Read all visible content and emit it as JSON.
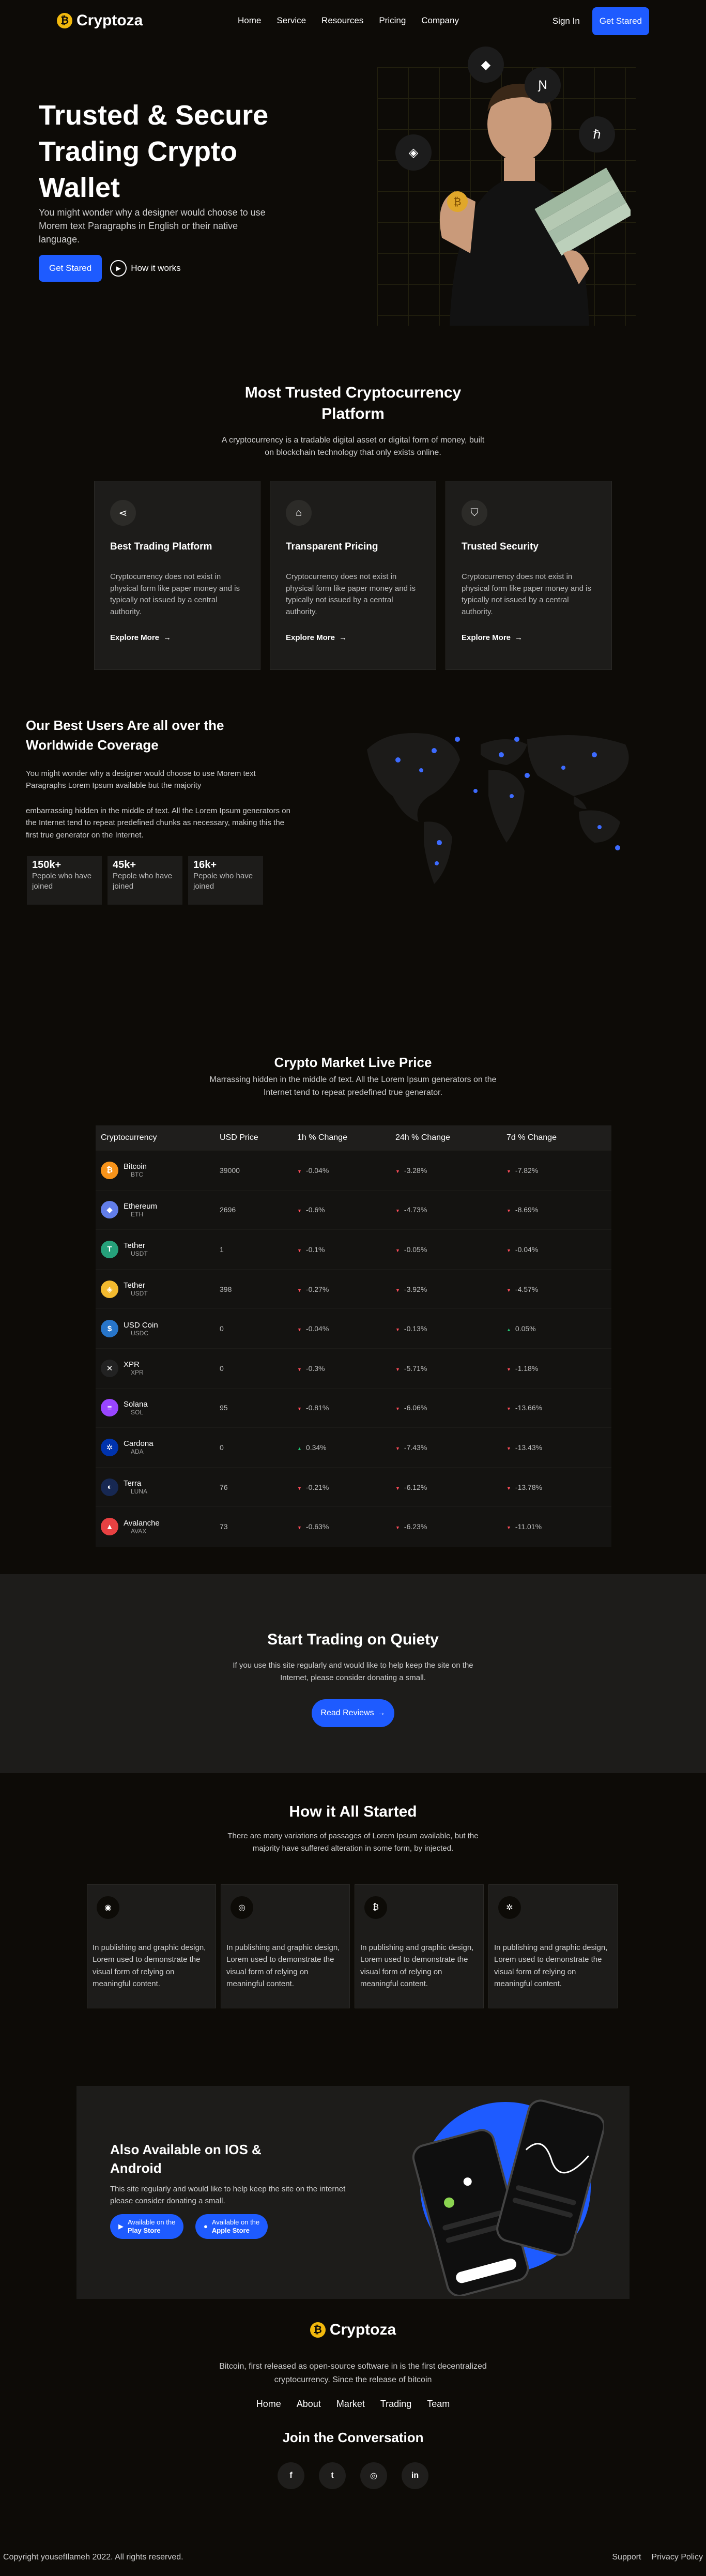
{
  "nav": {
    "brand": "Cryptoza",
    "brand_icon": "bitcoin-icon",
    "links": [
      "Home",
      "Service",
      "Resources",
      "Pricing",
      "Company"
    ],
    "sign_in": "Sign In",
    "cta": "Get Stared"
  },
  "hero": {
    "title": "Trusted & Secure Trading Crypto Wallet",
    "subtitle": "You might wonder why a designer would choose to use Morem text Paragraphs in English or their native language.",
    "cta": "Get Stared",
    "how": "How it works"
  },
  "platform": {
    "title": "Most Trusted Cryptocurrency Platform",
    "subtitle": "A cryptocurrency is a tradable digital asset or digital form of money, built on blockchain technology that only exists online.",
    "features": [
      {
        "icon": "share-icon",
        "title": "Best Trading Platform",
        "text": "Cryptocurrency does not exist in physical form like paper money and is typically not issued by a central authority.",
        "more": "Explore More"
      },
      {
        "icon": "tag-icon",
        "title": "Transparent Pricing",
        "text": "Cryptocurrency does not exist in physical form like paper money and is typically not issued by a central authority.",
        "more": "Explore More"
      },
      {
        "icon": "shield-icon",
        "title": "Trusted Security",
        "text": "Cryptocurrency does not exist in physical form like paper money and is typically not issued by a central authority.",
        "more": "Explore More"
      }
    ]
  },
  "users": {
    "title": "Our Best Users Are all over the Worldwide Coverage",
    "p1": "You might wonder why a designer would choose to use Morem text Paragraphs Lorem Ipsum available but the majority",
    "p2": "embarrassing hidden in the middle of text. All the Lorem Ipsum generators on the Internet tend to repeat predefined chunks as necessary, making this the first true generator on the Internet.",
    "stats": [
      {
        "value": "150k+",
        "label": "Pepole who have joined"
      },
      {
        "value": "45k+",
        "label": "Pepole who have joined"
      },
      {
        "value": "16k+",
        "label": "Pepole who have joined"
      }
    ]
  },
  "market": {
    "title": "Crypto Market Live Price",
    "subtitle": "Marrassing hidden in the middle of text. All the Lorem Ipsum generators on the Internet tend to repeat predefined true generator.",
    "columns": [
      "Cryptocurrency",
      "USD Price",
      "1h % Change",
      "24h % Change",
      "7d % Change"
    ],
    "rows": [
      {
        "name": "Bitcoin",
        "sym": "BTC",
        "price": "39000",
        "h1": "-0.04%",
        "h24": "-3.28%",
        "d7": "-7.82%",
        "color": "#f7931a",
        "glyph": "₿"
      },
      {
        "name": "Ethereum",
        "sym": "ETH",
        "price": "2696",
        "h1": "-0.6%",
        "h24": "-4.73%",
        "d7": "-8.69%",
        "color": "#627eea",
        "glyph": "◆"
      },
      {
        "name": "Tether",
        "sym": "USDT",
        "price": "1",
        "h1": "-0.1%",
        "h24": "-0.05%",
        "d7": "-0.04%",
        "color": "#26a17b",
        "glyph": "T"
      },
      {
        "name": "Tether",
        "sym": "USDT",
        "price": "398",
        "h1": "-0.27%",
        "h24": "-3.92%",
        "d7": "-4.57%",
        "color": "#f3ba2f",
        "glyph": "◈"
      },
      {
        "name": "USD Coin",
        "sym": "USDC",
        "price": "0",
        "h1": "-0.04%",
        "h24": "-0.13%",
        "d7": "0.05%",
        "color": "#2775ca",
        "glyph": "$"
      },
      {
        "name": "XPR",
        "sym": "XPR",
        "price": "0",
        "h1": "-0.3%",
        "h24": "-5.71%",
        "d7": "-1.18%",
        "color": "#222222",
        "glyph": "✕"
      },
      {
        "name": "Solana",
        "sym": "SOL",
        "price": "95",
        "h1": "-0.81%",
        "h24": "-6.06%",
        "d7": "-13.66%",
        "color": "#9945ff",
        "glyph": "≡"
      },
      {
        "name": "Cardona",
        "sym": "ADA",
        "price": "0",
        "h1": "0.34%",
        "h24": "-7.43%",
        "d7": "-13.43%",
        "color": "#0033ad",
        "glyph": "✲"
      },
      {
        "name": "Terra",
        "sym": "LUNA",
        "price": "76",
        "h1": "-0.21%",
        "h24": "-6.12%",
        "d7": "-13.78%",
        "color": "#172852",
        "glyph": "◐"
      },
      {
        "name": "Avalanche",
        "sym": "AVAX",
        "price": "73",
        "h1": "-0.63%",
        "h24": "-6.23%",
        "d7": "-11.01%",
        "color": "#e84142",
        "glyph": "▲"
      }
    ]
  },
  "trading": {
    "title": "Start Trading on Quiety",
    "text": "If you use this site regularly and would like to help keep the site on the Internet, please consider donating a small.",
    "cta": "Read Reviews"
  },
  "started": {
    "title": "How it All Started",
    "subtitle": "There are many variations of passages of Lorem Ipsum available, but the majority have suffered alteration in some form, by injected.",
    "cards": [
      {
        "icon": "pulse-icon",
        "text": "In publishing and graphic design, Lorem used to demonstrate the visual form of relying on meaningful content."
      },
      {
        "icon": "target-icon",
        "text": "In publishing and graphic design, Lorem used to demonstrate the visual form of relying on meaningful content."
      },
      {
        "icon": "bitcoin-icon",
        "text": "In publishing and graphic design, Lorem used to demonstrate the visual form of relying on meaningful content."
      },
      {
        "icon": "sun-icon",
        "text": "In publishing and graphic design, Lorem used to demonstrate the visual form of relying on meaningful content."
      }
    ]
  },
  "app": {
    "title": "Also Available on IOS & Android",
    "text": "This site regularly and would like to help keep the site on the internet please consider donating a small.",
    "play_top": "Available on the",
    "play_bottom": "Play Store",
    "apple_top": "Available on the",
    "apple_bottom": "Apple Store"
  },
  "footer": {
    "brand": "Cryptoza",
    "text": "Bitcoin, first released as open-source software in is the first decentralized cryptocurrency. Since the release of bitcoin",
    "links": [
      "Home",
      "About",
      "Market",
      "Trading",
      "Team"
    ],
    "join": "Join the Conversation",
    "socials": [
      "facebook-icon",
      "twitter-icon",
      "instagram-icon",
      "linkedin-icon"
    ],
    "copyright": "Copyright yousefIlameh 2022. All rights reserved.",
    "support": "Support",
    "privacy": "Privacy Policy"
  },
  "colors": {
    "accent": "#1e5bff",
    "brand": "#f2b90d",
    "negative": "#ff4d5a",
    "positive": "#23c271",
    "bg": "#0d0b07",
    "card": "#1d1c1a"
  }
}
